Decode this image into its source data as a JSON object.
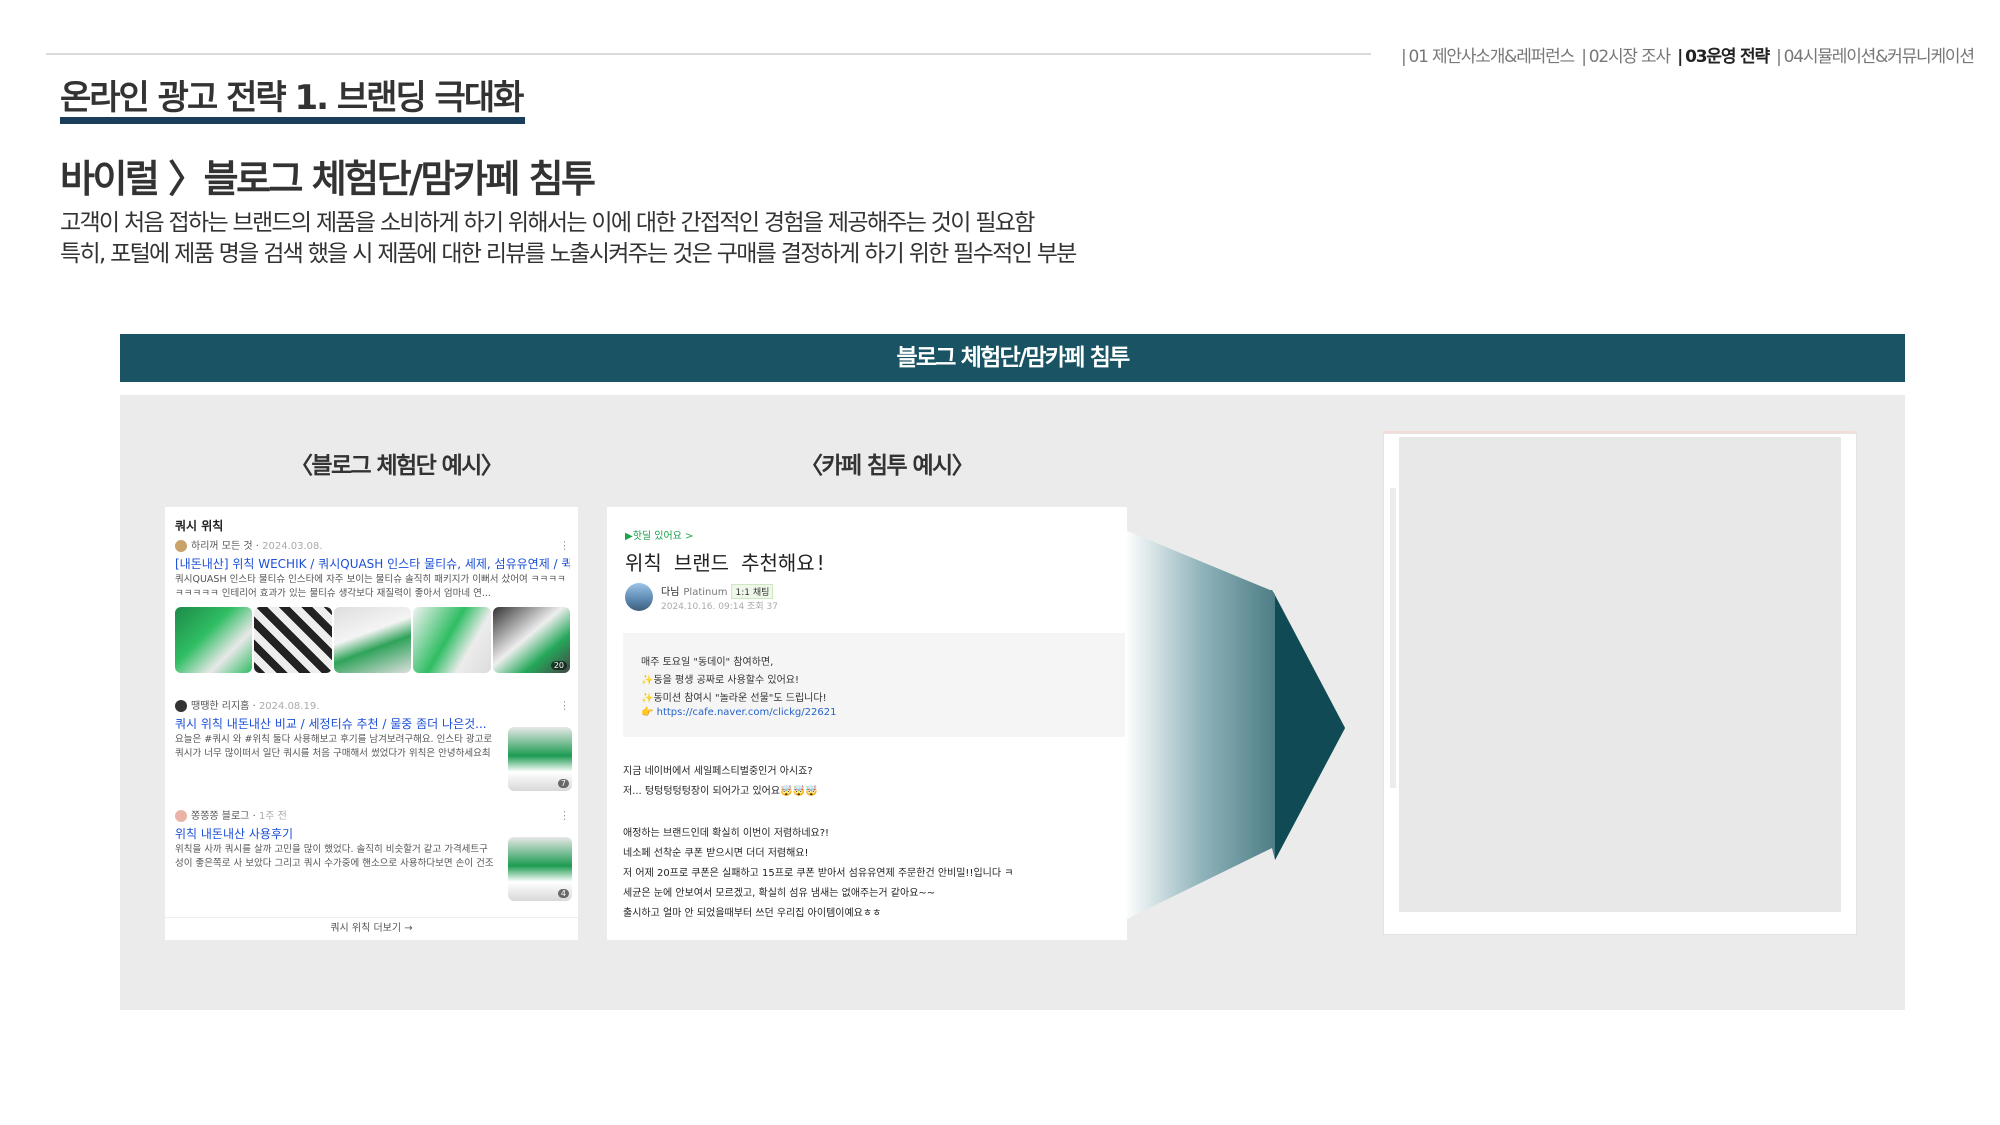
{
  "nav": {
    "items": [
      {
        "label": "01 제안사소개&레퍼런스",
        "active": false
      },
      {
        "label": "02시장 조사",
        "active": false
      },
      {
        "label": "03운영 전략",
        "active": true
      },
      {
        "label": "04시뮬레이션&커뮤니케이션",
        "active": false
      }
    ],
    "separator": "|"
  },
  "section_title": "온라인 광고 전략 1. 브랜딩 극대화",
  "headline": "바이럴 〉블로그 체험단/맘카페 침투",
  "description": {
    "line1": "고객이 처음 접하는 브랜드의 제품을 소비하게 하기 위해서는 이에 대한 간접적인 경험을 제공해주는 것이 필요함",
    "line2": "특히, 포털에 제품 명을 검색 했을 시 제품에 대한 리뷰를 노출시켜주는 것은 구매를 결정하게 하기 위한 필수적인 부분"
  },
  "band_label": "블로그 체험단/맘카페 침투",
  "captions": {
    "blog": "〈블로그 체험단 예시〉",
    "cafe": "〈카페 침투 예시〉"
  },
  "blog": {
    "query": "쿼시 위칙",
    "items": [
      {
        "author": "하리꺼 모든 것",
        "date": "2024.03.08.",
        "title": "[내돈내산] 위칙 WECHIK / 쿼시QUASH 인스타 물티슈, 세제, 섬유유연제 / 퀵...",
        "snippet": "쿼시QUASH 인스타 물티슈 인스타에 자주 보이는 물티슈 솔직히 패키지가 이뻐서 샀어여 ㅋㅋㅋㅋ ㅋㅋㅋㅋㅋ 인테리어 효과가 있는 물티슈 생각보다 재질력이 좋아서 엄마네 연..."
      },
      {
        "author": "땡땡한 리지홈",
        "date": "2024.08.19.",
        "title": "쿼시 위칙 내돈내산 비교 / 세정티슈 추천 / 물중 좀더 나은것...",
        "snippet": "요늘은 #쿼시 와 #위칙 둘다 사용해보고 후기를 남겨보려구해요. 인스타 광고로 쿼시가 너무 많이떠서 일단 쿼시를 처음 구매해서 썼었다가 위칙은 안녕하세요최최정이에요에서 공구를 하길래 추가구매해서 지금 꾸..."
      },
      {
        "author": "쫑쫑쫑 블로그",
        "date": "1주 전",
        "title": "위칙 내돈내산 사용후기",
        "snippet": "위칙을 사까 쿼시를 살까 고민을 많이 했었다. 솔직히 비슷할거 같고 가격세트구성이 좋은쪽로 사 보았다 그리고 쿼시 수가중에 핸소으로 사용하다보면 손이 건조해진다는 느낌이 든다고 해서 위칙을 산건데 ......"
      }
    ],
    "thumb_badges": [
      "20",
      "7",
      "4"
    ],
    "more_label": "쿼시 위칙 더보기 →"
  },
  "cafe": {
    "pin_label": "▶핫딜 있어요 >",
    "title": "위칙 브랜드 추천해요!",
    "author": "다님",
    "grade": "Platinum",
    "badge": "1:1 채팅",
    "date": "2024.10.16. 09:14  조회 37",
    "quote": {
      "line1": "매주 토요일 \"동데이\" 참여하면,",
      "line2": "✨동을 평생 공짜로 사용할수 있어요!",
      "line3": "✨동미션 참여시 \"놀라운 선물\"도 드립니다!",
      "line4": "👉 https://cafe.naver.com/clickg/22621"
    },
    "body": {
      "line1": "지금 네이버에서 세일페스티벌중인거 아시죠?",
      "line2": "저... 텅텅텅텅텅장이 되어가고 있어요🤯🤯🤯",
      "line3": "애정하는 브랜드인데 확실히 이번이 저렴하네요?!",
      "line4": "네소페 선착순 쿠폰 받으시면 더더 저렴해요!",
      "line5": "저 어제 20프로 쿠폰은 실패하고 15프로 쿠폰 받아서 섬유유연제 주문한건 안비밀!!입니다 ㅋ",
      "line6": "세균은 눈에 안보여서 모르겠고, 확실히 섬유 냄새는 없애주는거 같아요~~",
      "line7": "출시하고 얼마 안 되었을때부터 쓰던 우리집 아이템이예요ㅎㅎ"
    }
  },
  "colors": {
    "band": "#1a5464",
    "title_bar": "#1a3d5c",
    "panel": "#ebebeb",
    "arrow_dark": "#0f4a55",
    "arrow_light": "#ffffff"
  },
  "icons": {
    "arrow": "right-arrow-gradient-icon"
  }
}
